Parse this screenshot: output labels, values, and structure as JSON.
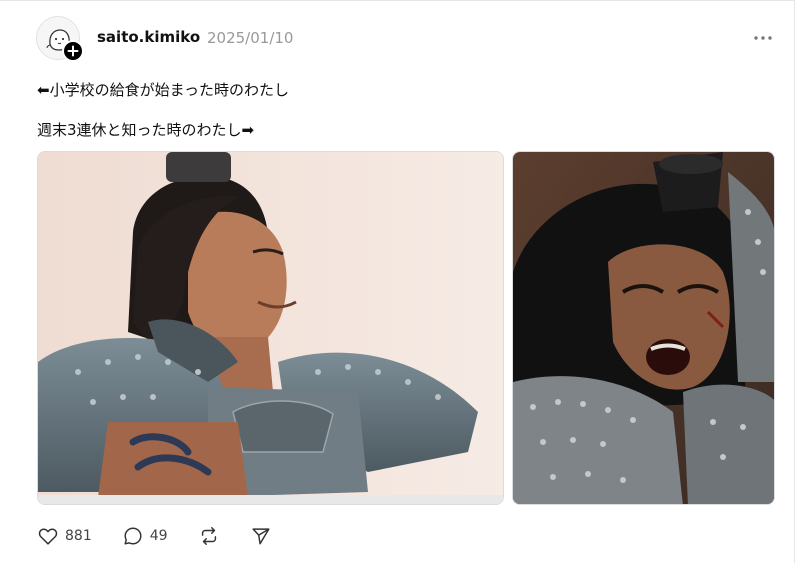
{
  "post": {
    "username": "saito.kimiko",
    "timestamp": "2025/01/10",
    "lines": [
      "⬅小学校の給食が始まった時のわたし",
      "週末3連休と知った時のわたし➡"
    ]
  },
  "actions": {
    "like_count": "881",
    "reply_count": "49"
  },
  "icons": {
    "like": "heart-icon",
    "reply": "reply-bubble-icon",
    "repost": "repost-icon",
    "share": "send-icon",
    "more": "more-dots-icon",
    "follow": "plus-icon"
  },
  "media": [
    {
      "name": "smiling-warrior-photo"
    },
    {
      "name": "shouting-warrior-photo"
    }
  ]
}
